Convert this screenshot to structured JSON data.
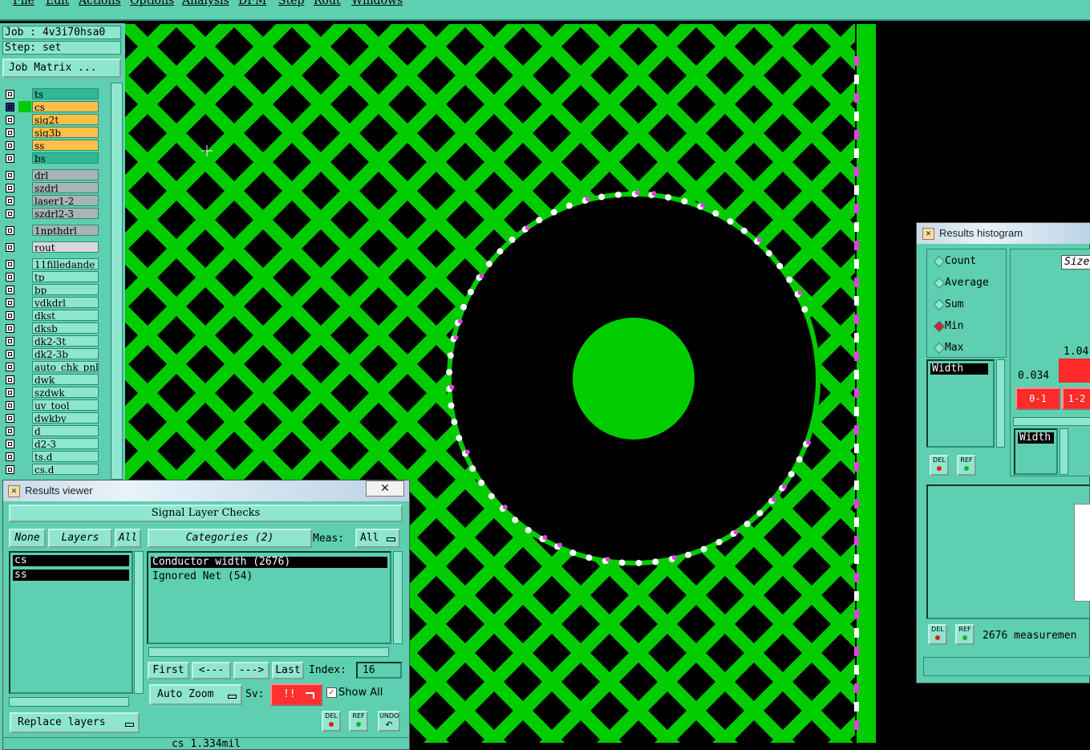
{
  "menu": [
    "File",
    "Edit",
    "Actions",
    "Options",
    "Analysis",
    "DFM",
    "Step",
    "Rout",
    "Windows"
  ],
  "job": {
    "label": "Job : 4v3i70hsa0",
    "step": "Step: set",
    "matrix_button": "Job Matrix ..."
  },
  "layers": [
    {
      "name": "ts",
      "color": "#2fb896"
    },
    {
      "name": "cs",
      "color": "#ffc04a",
      "active": true
    },
    {
      "name": "sig2t",
      "color": "#ffc04a"
    },
    {
      "name": "sig3b",
      "color": "#ffc04a"
    },
    {
      "name": "ss",
      "color": "#ffc04a"
    },
    {
      "name": "bs",
      "color": "#2fb896"
    },
    {
      "name": "drl",
      "color": "#a9b4b4"
    },
    {
      "name": "szdrl",
      "color": "#a9b4b4"
    },
    {
      "name": "laser1-2",
      "color": "#a9b4b4"
    },
    {
      "name": "szdrl2-3",
      "color": "#a9b4b4"
    },
    {
      "name": "1npthdrl",
      "color": "#a9b4b4"
    },
    {
      "name": "rout",
      "color": "#d8d8d8"
    },
    {
      "name": "11filledande",
      "color": "#8fe6cf"
    },
    {
      "name": "tp",
      "color": "#8fe6cf"
    },
    {
      "name": "bp",
      "color": "#8fe6cf"
    },
    {
      "name": "ydkdrl",
      "color": "#8fe6cf"
    },
    {
      "name": "dkst",
      "color": "#8fe6cf"
    },
    {
      "name": "dksb",
      "color": "#8fe6cf"
    },
    {
      "name": "dk2-3t",
      "color": "#8fe6cf"
    },
    {
      "name": "dk2-3b",
      "color": "#8fe6cf"
    },
    {
      "name": "auto_chk_pnl",
      "color": "#8fe6cf"
    },
    {
      "name": "dwk",
      "color": "#8fe6cf"
    },
    {
      "name": "szdwk",
      "color": "#8fe6cf"
    },
    {
      "name": "uv_tool",
      "color": "#8fe6cf"
    },
    {
      "name": "dwkby",
      "color": "#8fe6cf"
    },
    {
      "name": "d",
      "color": "#8fe6cf"
    },
    {
      "name": "d2-3",
      "color": "#8fe6cf"
    },
    {
      "name": "ts.d",
      "color": "#8fe6cf"
    },
    {
      "name": "cs.d",
      "color": "#8fe6cf"
    }
  ],
  "results_viewer": {
    "title": "Results viewer",
    "header": "Signal Layer Checks",
    "none_btn": "None",
    "layers_btn": "Layers",
    "all_btn": "All",
    "layer_list": [
      "cs",
      "ss"
    ],
    "categories_btn": "Categories (2)",
    "meas_label": "Meas:",
    "meas_value": "All",
    "categories": [
      "Conductor width (2676)",
      "Ignored Net (54)"
    ],
    "first": "First",
    "prev": "<---",
    "next": "--->",
    "last": "Last",
    "index_label": "Index:",
    "index_value": "16",
    "auto_zoom": "Auto Zoom",
    "sv_label": "Sv:",
    "sv_value": "!!",
    "show_all": "Show All",
    "replace_layers": "Replace layers",
    "status": "cs 1.334mil",
    "del": "DEL",
    "ref": "REF",
    "undo": "UNDO"
  },
  "histogram": {
    "title": "Results histogram",
    "options": [
      "Count",
      "Average",
      "Sum",
      "Min",
      "Max"
    ],
    "selected": "Min",
    "size_label": "Size",
    "val_high": "1.04",
    "val_low": "0.034",
    "bin1": "0-1",
    "bin2": "1-2",
    "list_item": "Width",
    "list_item2": "Width",
    "measurements": "2676 measuremen",
    "del": "DEL",
    "ref": "REF"
  },
  "colors": {
    "copper": "#00cc00",
    "marker": "#e040e0",
    "panel": "#5ecfb0"
  }
}
